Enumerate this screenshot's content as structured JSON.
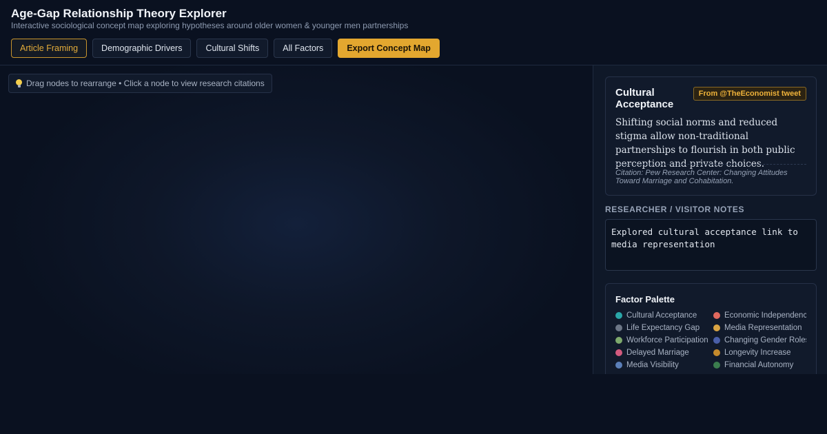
{
  "header": {
    "title": "Age-Gap Relationship Theory Explorer",
    "subtitle": "Interactive sociological concept map exploring hypotheses around older women & younger men partnerships"
  },
  "toolbar": {
    "buttons": [
      {
        "label": "Article Framing",
        "state": "active"
      },
      {
        "label": "Demographic Drivers",
        "state": "default"
      },
      {
        "label": "Cultural Shifts",
        "state": "default"
      },
      {
        "label": "All Factors",
        "state": "default"
      },
      {
        "label": "Export Concept Map",
        "state": "primary"
      }
    ]
  },
  "canvas": {
    "hint_icon": "lightbulb-icon",
    "hint": "Drag nodes to rearrange • Click a node to view research citations"
  },
  "detail": {
    "title": "Cultural Acceptance",
    "source_badge": "From @TheEconomist tweet",
    "description": "Shifting social norms and reduced stigma allow non-traditional partnerships to flourish in both public perception and private choices.",
    "citation": "Citation: Pew Research Center: Changing Attitudes Toward Marriage and Cohabitation."
  },
  "notes": {
    "label": "RESEARCHER / VISITOR NOTES",
    "value": "Explored cultural acceptance link to media representation"
  },
  "palette": {
    "title": "Factor Palette",
    "items": [
      {
        "label": "Cultural Acceptance",
        "color": "#2aa6a8"
      },
      {
        "label": "Economic Independence",
        "color": "#e0685e"
      },
      {
        "label": "Life Expectancy Gap",
        "color": "#6c7686"
      },
      {
        "label": "Media Representation",
        "color": "#d9a443"
      },
      {
        "label": "Workforce Participation",
        "color": "#7ea96d"
      },
      {
        "label": "Changing Gender Roles",
        "color": "#4a5fa8"
      },
      {
        "label": "Delayed Marriage",
        "color": "#d25a7e"
      },
      {
        "label": "Longevity Increase",
        "color": "#c48a2c"
      },
      {
        "label": "Media Visibility",
        "color": "#5b7fb8"
      },
      {
        "label": "Financial Autonomy",
        "color": "#3b7d4e"
      }
    ]
  },
  "colors": {
    "accent": "#e3a72f",
    "background": "#0a1120",
    "panel": "#111a2b"
  }
}
